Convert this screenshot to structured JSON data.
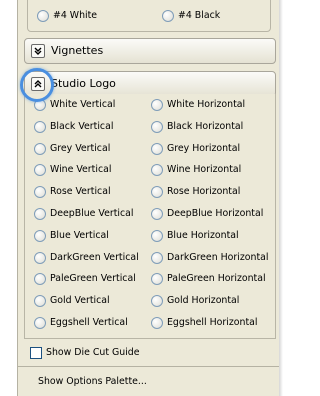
{
  "top_options": [
    "#4 White",
    "#4 Black"
  ],
  "vignettes": {
    "title": "Vignettes"
  },
  "studio_logo": {
    "title": "Studio Logo",
    "left": [
      "White Vertical",
      "Black Vertical",
      "Grey Vertical",
      "Wine Vertical",
      "Rose Vertical",
      "DeepBlue Vertical",
      "Blue Vertical",
      "DarkGreen Vertical",
      "PaleGreen Vertical",
      "Gold Vertical",
      "Eggshell Vertical"
    ],
    "right": [
      "White Horizontal",
      "Black Horizontal",
      "Grey Horizontal",
      "Wine Horizontal",
      "Rose Horizontal",
      "DeepBlue Horizontal",
      "Blue Horizontal",
      "DarkGreen Horizontal",
      "PaleGreen Horizontal",
      "Gold Horizontal",
      "Eggshell Horizontal"
    ]
  },
  "die_cut": {
    "label": "Show Die Cut Guide"
  },
  "footer": {
    "label": "Show Options Palette..."
  },
  "colors": {
    "panel_bg": "#ece9d8",
    "highlight_ring": "#4a8fe0",
    "radio_border": "#7f9db9"
  },
  "icons": {
    "vignettes_toggle": "chevron-down-double-icon",
    "studio_logo_toggle": "chevron-up-double-icon"
  }
}
